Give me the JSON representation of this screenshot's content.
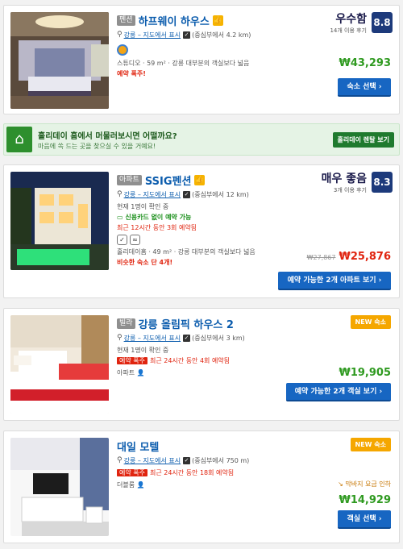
{
  "listings": [
    {
      "tag": "펜션",
      "name": "하프웨이 하우스",
      "location_link": "강릉 – 지도에서 표시",
      "distance": "(중심부에서 4.2 km)",
      "room_line": "스튜디오 · 59 m² · 강릉 대부분의 객실보다 넓음",
      "alert": "예약 폭주!",
      "rating_word": "우수함",
      "review_count": "14개 이용 후기",
      "score": "8.8",
      "price": "₩43,293",
      "button": "숙소 선택 ›"
    },
    {
      "tag": "아파트",
      "name": "SSIG펜션",
      "location_link": "강릉 – 지도에서 표시",
      "distance": "(중심부에서 12 km)",
      "availability": "현재 1명이 확인 중",
      "no_card": "신용카드 없이 예약 가능",
      "recent": "최근 12시간 동안 3회 예약됨",
      "room_line": "홀리데이홈 · 49 m² · 강릉 대부분의 객실보다 넓음",
      "similar": "비슷한 숙소 단 4개!",
      "rating_word": "매우 좋음",
      "review_count": "3개 이용 후기",
      "score": "8.3",
      "old_price": "₩27,867",
      "price": "₩25,876",
      "button": "예약 가능한 2개 아파트 보기 ›"
    },
    {
      "tag": "빌라",
      "name": "강릉 올림픽 하우스 2",
      "location_link": "강릉 – 지도에서 표시",
      "distance": "(중심부에서 3 km)",
      "availability": "현재 1명이 확인 중",
      "hot": "예약 폭주",
      "recent": "최근 24시간 동안 4회 예약됨",
      "room_line": "아파트",
      "badge": "NEW 숙소",
      "price": "₩19,905",
      "button": "예약 가능한 2개 객실 보기 ›"
    },
    {
      "name": "대일 모텔",
      "location_link": "강릉 – 지도에서 표시",
      "distance": "(중심부에서 750 m)",
      "hot": "예약 폭주",
      "recent": "최근 24시간 동안 18회 예약됨",
      "room_line": "더블룸",
      "badge": "NEW 숙소",
      "discount": "막바지 요금 인하",
      "price": "₩14,929",
      "button": "객실 선택 ›"
    }
  ],
  "promo": {
    "title": "홀리데이 홈에서 머물러보시면 어떨까요?",
    "subtitle": "마음에 쏙 드는 곳을 찾으실 수 있을 거예요!",
    "button": "홀리데이 렌탈 보기"
  },
  "icons": {
    "pin": "map-pin-icon",
    "thumb": "thumbs-up-icon",
    "home": "house-icon"
  },
  "colors": {
    "link": "#0b5cad",
    "score_bg": "#1d3a7b",
    "price": "#2f9a20",
    "button": "#1766c2",
    "alert": "#e0240f",
    "new_badge": "#f5a700"
  }
}
